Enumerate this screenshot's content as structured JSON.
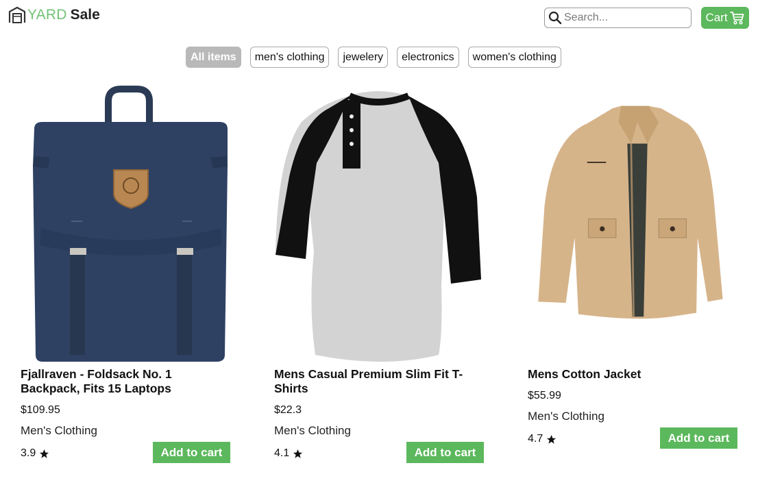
{
  "header": {
    "logo_yard": "YARD",
    "logo_sale": "Sale",
    "search_placeholder": "Search...",
    "cart_label": "Cart"
  },
  "filters": [
    "All items",
    "men's clothing",
    "jewelery",
    "electronics",
    "women's clothing"
  ],
  "products": [
    {
      "title": "Fjallraven - Foldsack No. 1 Backpack, Fits 15 Laptops",
      "price": "$109.95",
      "category": "Men's Clothing",
      "rating": "3.9",
      "button": "Add to cart",
      "image": "navy-backpack-image"
    },
    {
      "title": "Mens Casual Premium Slim Fit T-Shirts",
      "price": "$22.3",
      "category": "Men's Clothing",
      "rating": "4.1",
      "button": "Add to cart",
      "image": "raglan-henley-shirt-image"
    },
    {
      "title": "Mens Cotton Jacket",
      "price": "$55.99",
      "category": "Men's Clothing",
      "rating": "4.7",
      "button": "Add to cart",
      "image": "khaki-jacket-image"
    }
  ],
  "colors": {
    "accent": "#5cb85c",
    "logo_green": "#72c277",
    "active_chip": "#b9b9b9"
  }
}
